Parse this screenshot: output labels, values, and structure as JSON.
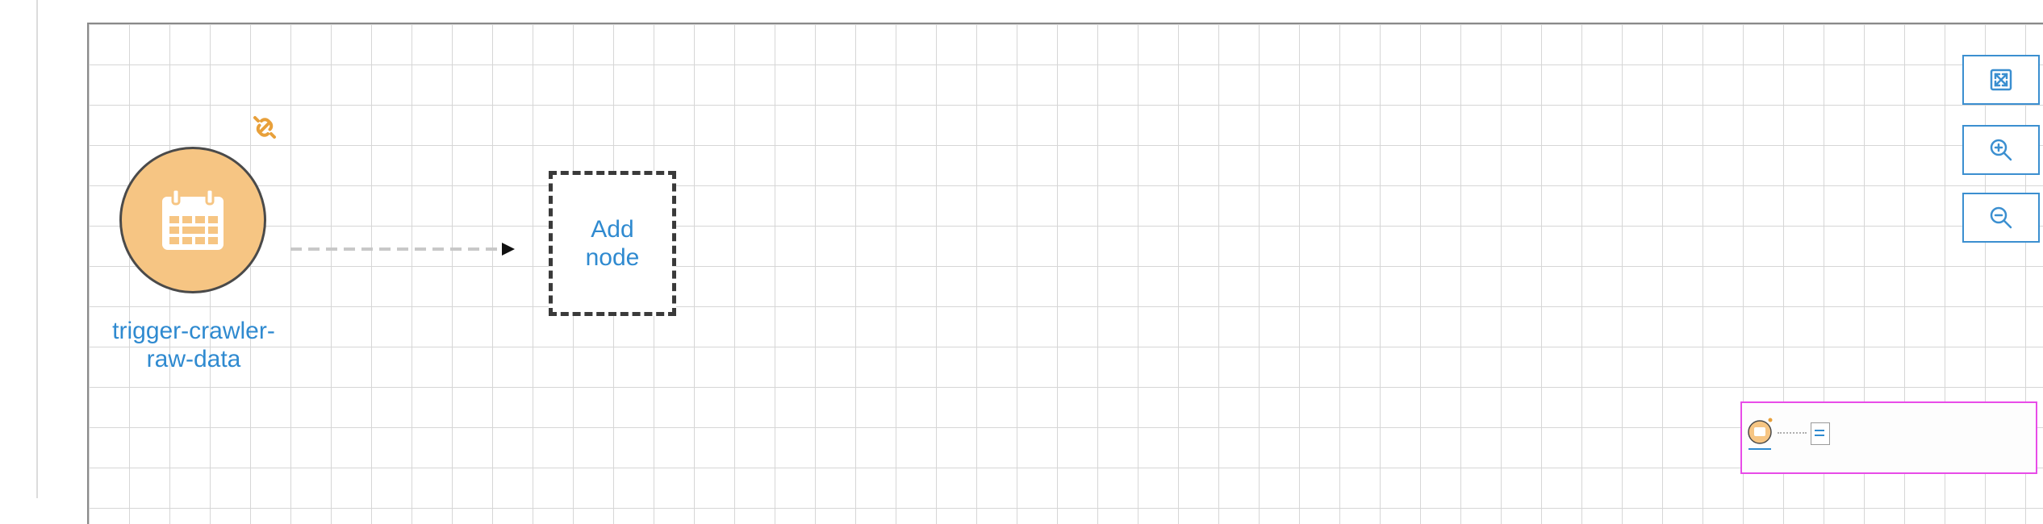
{
  "workflow": {
    "trigger_node": {
      "label": "trigger-crawler-raw-data",
      "icon": "calendar-icon",
      "fill_color": "#f6c583",
      "border_color": "#4a4a4a"
    },
    "link_badge": {
      "icon": "link-icon",
      "color": "#e8a03a"
    },
    "add_node": {
      "label": "Add node"
    }
  },
  "controls": {
    "fit": {
      "icon": "fit-screen-icon"
    },
    "zoom_in": {
      "icon": "zoom-in-icon"
    },
    "zoom_out": {
      "icon": "zoom-out-icon"
    },
    "accent_color": "#3b8fd0"
  },
  "minimap": {
    "border_color": "#e84ce8"
  }
}
